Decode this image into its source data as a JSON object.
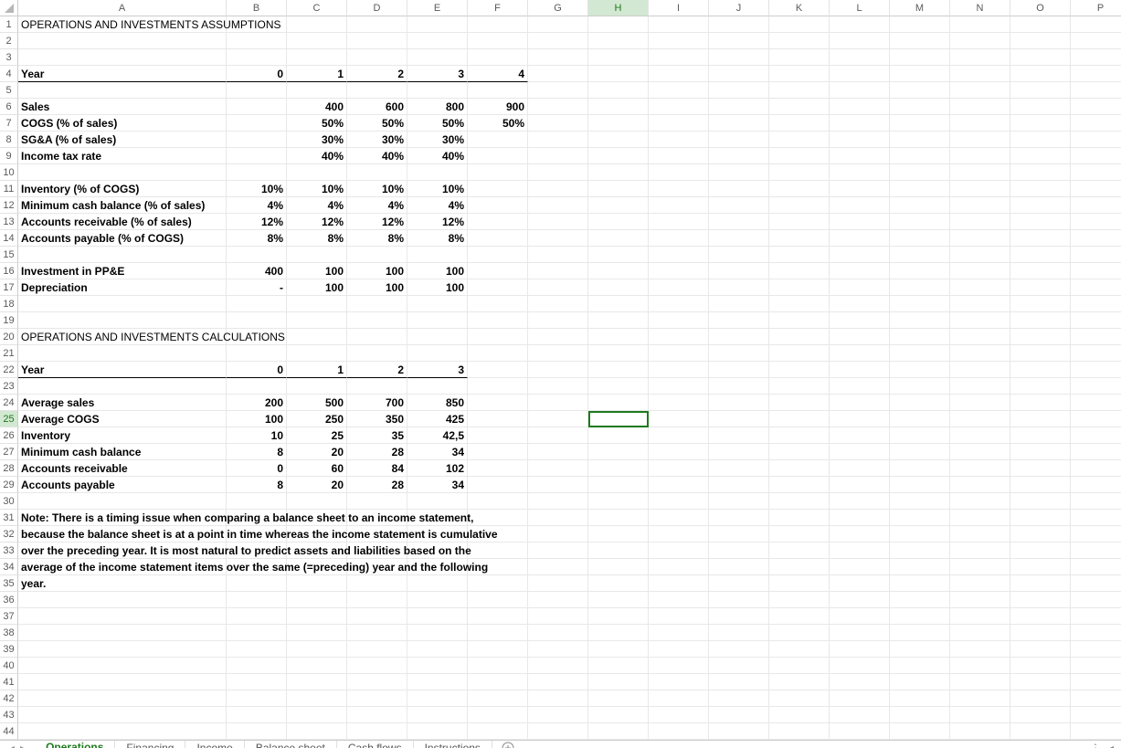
{
  "columns": [
    "A",
    "B",
    "C",
    "D",
    "E",
    "F",
    "G",
    "H",
    "I",
    "J",
    "K",
    "L",
    "M",
    "N",
    "O",
    "P"
  ],
  "rowCount": 44,
  "activeRow": 25,
  "activeCol": "H",
  "activeCell": {
    "row": 25,
    "col": "H"
  },
  "tabs": [
    {
      "label": "Operations",
      "active": true
    },
    {
      "label": "Financing",
      "active": false
    },
    {
      "label": "Income",
      "active": false
    },
    {
      "label": "Balance sheet",
      "active": false
    },
    {
      "label": "Cash flows",
      "active": false
    },
    {
      "label": "Instructions",
      "active": false
    }
  ],
  "cells": {
    "r1": {
      "A": {
        "v": "OPERATIONS AND INVESTMENTS ASSUMPTIONS",
        "span": true
      }
    },
    "r4": {
      "A": {
        "v": "Year",
        "u": true,
        "b": true
      },
      "B": {
        "v": "0",
        "r": true,
        "u": true,
        "b": true
      },
      "C": {
        "v": "1",
        "r": true,
        "u": true,
        "b": true
      },
      "D": {
        "v": "2",
        "r": true,
        "u": true,
        "b": true
      },
      "E": {
        "v": "3",
        "r": true,
        "u": true,
        "b": true
      },
      "F": {
        "v": "4",
        "r": true,
        "u": true,
        "b": true
      }
    },
    "r6": {
      "A": {
        "v": "Sales",
        "b": true
      },
      "C": {
        "v": "400",
        "r": true,
        "b": true
      },
      "D": {
        "v": "600",
        "r": true,
        "b": true
      },
      "E": {
        "v": "800",
        "r": true,
        "b": true
      },
      "F": {
        "v": "900",
        "r": true,
        "b": true
      }
    },
    "r7": {
      "A": {
        "v": "COGS (% of sales)",
        "b": true
      },
      "C": {
        "v": "50%",
        "r": true,
        "b": true
      },
      "D": {
        "v": "50%",
        "r": true,
        "b": true
      },
      "E": {
        "v": "50%",
        "r": true,
        "b": true
      },
      "F": {
        "v": "50%",
        "r": true,
        "b": true
      }
    },
    "r8": {
      "A": {
        "v": "SG&A (% of sales)",
        "b": true
      },
      "C": {
        "v": "30%",
        "r": true,
        "b": true
      },
      "D": {
        "v": "30%",
        "r": true,
        "b": true
      },
      "E": {
        "v": "30%",
        "r": true,
        "b": true
      }
    },
    "r9": {
      "A": {
        "v": "Income tax rate",
        "b": true
      },
      "C": {
        "v": "40%",
        "r": true,
        "b": true
      },
      "D": {
        "v": "40%",
        "r": true,
        "b": true
      },
      "E": {
        "v": "40%",
        "r": true,
        "b": true
      }
    },
    "r11": {
      "A": {
        "v": "Inventory (% of COGS)",
        "b": true
      },
      "B": {
        "v": "10%",
        "r": true,
        "b": true
      },
      "C": {
        "v": "10%",
        "r": true,
        "b": true
      },
      "D": {
        "v": "10%",
        "r": true,
        "b": true
      },
      "E": {
        "v": "10%",
        "r": true,
        "b": true
      }
    },
    "r12": {
      "A": {
        "v": "Minimum cash balance (% of sales)",
        "b": true
      },
      "B": {
        "v": "4%",
        "r": true,
        "b": true
      },
      "C": {
        "v": "4%",
        "r": true,
        "b": true
      },
      "D": {
        "v": "4%",
        "r": true,
        "b": true
      },
      "E": {
        "v": "4%",
        "r": true,
        "b": true
      }
    },
    "r13": {
      "A": {
        "v": "Accounts receivable (% of sales)",
        "b": true
      },
      "B": {
        "v": "12%",
        "r": true,
        "b": true
      },
      "C": {
        "v": "12%",
        "r": true,
        "b": true
      },
      "D": {
        "v": "12%",
        "r": true,
        "b": true
      },
      "E": {
        "v": "12%",
        "r": true,
        "b": true
      }
    },
    "r14": {
      "A": {
        "v": "Accounts payable (% of COGS)",
        "b": true
      },
      "B": {
        "v": "8%",
        "r": true,
        "b": true
      },
      "C": {
        "v": "8%",
        "r": true,
        "b": true
      },
      "D": {
        "v": "8%",
        "r": true,
        "b": true
      },
      "E": {
        "v": "8%",
        "r": true,
        "b": true
      }
    },
    "r16": {
      "A": {
        "v": "Investment in PP&E",
        "b": true
      },
      "B": {
        "v": "400",
        "r": true,
        "b": true
      },
      "C": {
        "v": "100",
        "r": true,
        "b": true
      },
      "D": {
        "v": "100",
        "r": true,
        "b": true
      },
      "E": {
        "v": "100",
        "r": true,
        "b": true
      }
    },
    "r17": {
      "A": {
        "v": "Depreciation",
        "b": true
      },
      "B": {
        "v": "-",
        "r": true,
        "b": true
      },
      "C": {
        "v": "100",
        "r": true,
        "b": true
      },
      "D": {
        "v": "100",
        "r": true,
        "b": true
      },
      "E": {
        "v": "100",
        "r": true,
        "b": true
      }
    },
    "r20": {
      "A": {
        "v": "OPERATIONS AND INVESTMENTS CALCULATIONS",
        "span": true
      }
    },
    "r22": {
      "A": {
        "v": "Year",
        "u": true,
        "b": true
      },
      "B": {
        "v": "0",
        "r": true,
        "u": true,
        "b": true
      },
      "C": {
        "v": "1",
        "r": true,
        "u": true,
        "b": true
      },
      "D": {
        "v": "2",
        "r": true,
        "u": true,
        "b": true
      },
      "E": {
        "v": "3",
        "r": true,
        "u": true,
        "b": true
      }
    },
    "r24": {
      "A": {
        "v": "Average sales",
        "b": true
      },
      "B": {
        "v": "200",
        "r": true,
        "b": true
      },
      "C": {
        "v": "500",
        "r": true,
        "b": true
      },
      "D": {
        "v": "700",
        "r": true,
        "b": true
      },
      "E": {
        "v": "850",
        "r": true,
        "b": true
      }
    },
    "r25": {
      "A": {
        "v": "Average COGS",
        "b": true
      },
      "B": {
        "v": "100",
        "r": true,
        "b": true
      },
      "C": {
        "v": "250",
        "r": true,
        "b": true
      },
      "D": {
        "v": "350",
        "r": true,
        "b": true
      },
      "E": {
        "v": "425",
        "r": true,
        "b": true
      }
    },
    "r26": {
      "A": {
        "v": "Inventory",
        "b": true
      },
      "B": {
        "v": "10",
        "r": true,
        "b": true
      },
      "C": {
        "v": "25",
        "r": true,
        "b": true
      },
      "D": {
        "v": "35",
        "r": true,
        "b": true
      },
      "E": {
        "v": "42,5",
        "r": true,
        "b": true
      }
    },
    "r27": {
      "A": {
        "v": "Minimum cash balance",
        "b": true
      },
      "B": {
        "v": "8",
        "r": true,
        "b": true
      },
      "C": {
        "v": "20",
        "r": true,
        "b": true
      },
      "D": {
        "v": "28",
        "r": true,
        "b": true
      },
      "E": {
        "v": "34",
        "r": true,
        "b": true
      }
    },
    "r28": {
      "A": {
        "v": "Accounts receivable",
        "b": true
      },
      "B": {
        "v": "0",
        "r": true,
        "b": true
      },
      "C": {
        "v": "60",
        "r": true,
        "b": true
      },
      "D": {
        "v": "84",
        "r": true,
        "b": true
      },
      "E": {
        "v": "102",
        "r": true,
        "b": true
      }
    },
    "r29": {
      "A": {
        "v": "Accounts payable",
        "b": true
      },
      "B": {
        "v": "8",
        "r": true,
        "b": true
      },
      "C": {
        "v": "20",
        "r": true,
        "b": true
      },
      "D": {
        "v": "28",
        "r": true,
        "b": true
      },
      "E": {
        "v": "34",
        "r": true,
        "b": true
      }
    },
    "r31": {
      "A": {
        "v": "Note:  There is a timing issue when comparing a balance sheet to an income statement,",
        "b": true,
        "span": true
      }
    },
    "r32": {
      "A": {
        "v": "because the balance sheet is at a point in time whereas the income statement is cumulative",
        "b": true,
        "span": true
      }
    },
    "r33": {
      "A": {
        "v": "over the preceding year.  It is most natural to predict assets and liabilities based on the",
        "b": true,
        "span": true
      }
    },
    "r34": {
      "A": {
        "v": "average of the income statement items over the same (=preceding) year and the following",
        "b": true,
        "span": true
      }
    },
    "r35": {
      "A": {
        "v": "year.",
        "b": true
      }
    }
  }
}
